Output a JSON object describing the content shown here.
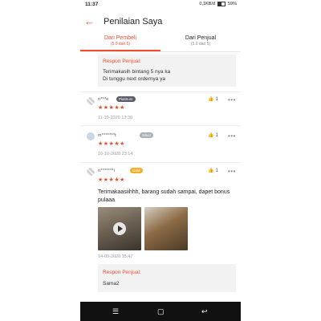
{
  "status": {
    "time": "11:37",
    "right_text": "0,1KB/d",
    "battery": "59%"
  },
  "header": {
    "title": "Penilaian Saya"
  },
  "tabs": [
    {
      "label": "Dari Pembeli",
      "sub": "(5.0 dari 5)"
    },
    {
      "label": "Dari Penjual",
      "sub": "(5.0 dari 5)"
    }
  ],
  "top_response": {
    "label": "Respon Penjual:",
    "line1": "Terimakasih bintang 5 nya ka",
    "line2": "Di tunggu next ordernya ya"
  },
  "reviews": [
    {
      "user": "n***e",
      "badge": "Platinum",
      "stars": "★★★★★",
      "date": "11-10-2020 13:30",
      "likes": "1"
    },
    {
      "user": "m*******t",
      "badge": "Silver",
      "stars": "★★★★★",
      "date": "10-10-2020 23:14",
      "likes": "1"
    },
    {
      "user": "n*******i",
      "badge": "Gold",
      "stars": "★★★★★",
      "date": "14-09-2020 15:47",
      "likes": "1",
      "text": "Terimakaasiihhh, barang sudah sampai, dapet bonus pulaaa",
      "response_label": "Respon Penjual:",
      "response_text": "Sama2"
    }
  ],
  "icons": {
    "back": "back-arrow-icon",
    "like": "thumbs-up-icon",
    "more": "more-dots-icon",
    "play": "play-icon"
  },
  "colors": {
    "accent": "#ee4d2d"
  }
}
